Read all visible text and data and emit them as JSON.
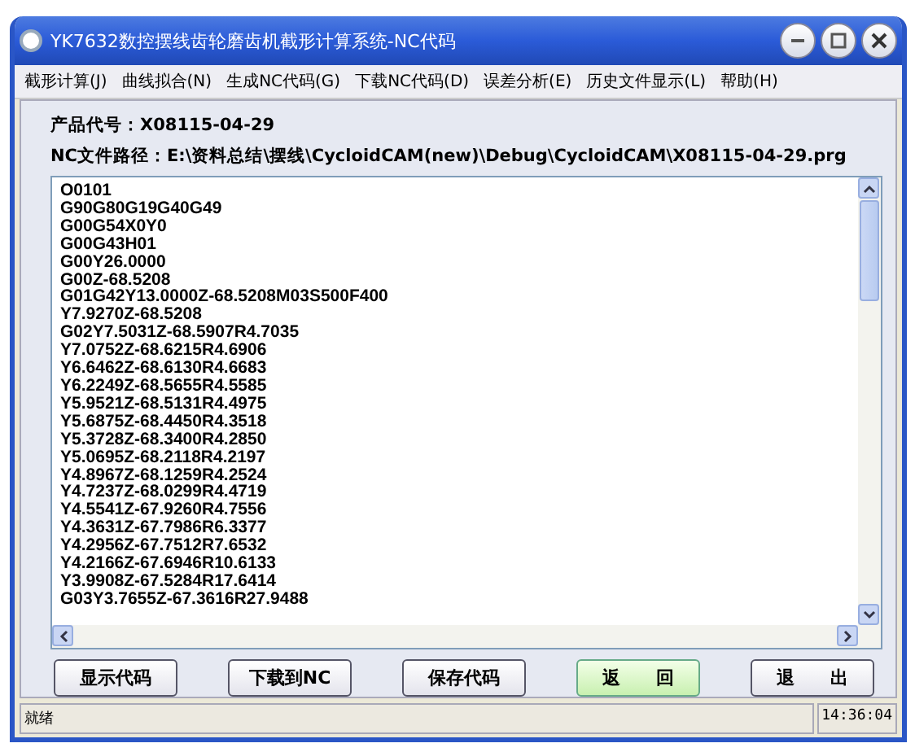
{
  "window": {
    "title": "YK7632数控摆线齿轮磨齿机截形计算系统-NC代码"
  },
  "menu": [
    "截形计算(J)",
    "曲线拟合(N)",
    "生成NC代码(G)",
    "下载NC代码(D)",
    "误差分析(E)",
    "历史文件显示(L)",
    "帮助(H)"
  ],
  "info": [
    {
      "label": "产品代号：",
      "value": "X08115-04-29"
    },
    {
      "label": "NC文件路径：",
      "value": "E:\\资料总结\\摆线\\CycloidCAM(new)\\Debug\\CycloidCAM\\X08115-04-29.prg"
    }
  ],
  "code_lines": [
    "O0101",
    "G90G80G19G40G49",
    "G00G54X0Y0",
    "G00G43H01",
    "G00Y26.0000",
    "G00Z-68.5208",
    "G01G42Y13.0000Z-68.5208M03S500F400",
    "Y7.9270Z-68.5208",
    "G02Y7.5031Z-68.5907R4.7035",
    "Y7.0752Z-68.6215R4.6906",
    "Y6.6462Z-68.6130R4.6683",
    "Y6.2249Z-68.5655R4.5585",
    "Y5.9521Z-68.5131R4.4975",
    "Y5.6875Z-68.4450R4.3518",
    "Y5.3728Z-68.3400R4.2850",
    "Y5.0695Z-68.2118R4.2197",
    "Y4.8967Z-68.1259R4.2524",
    "Y4.7237Z-68.0299R4.4719",
    "Y4.5541Z-67.9260R4.7556",
    "Y4.3631Z-67.7986R6.3377",
    "Y4.2956Z-67.7512R7.6532",
    "Y4.2166Z-67.6946R10.6133",
    "Y3.9908Z-67.5284R17.6414",
    "G03Y3.7655Z-67.3616R27.9488"
  ],
  "buttons": [
    {
      "label": "显示代码",
      "selected": false
    },
    {
      "label": "下载到NC",
      "selected": false
    },
    {
      "label": "保存代码",
      "selected": false
    },
    {
      "label": "返　　回",
      "selected": true
    },
    {
      "label": "退　　出",
      "selected": false
    }
  ],
  "status_bar": {
    "message": "就绪",
    "time": "14:36:04"
  }
}
